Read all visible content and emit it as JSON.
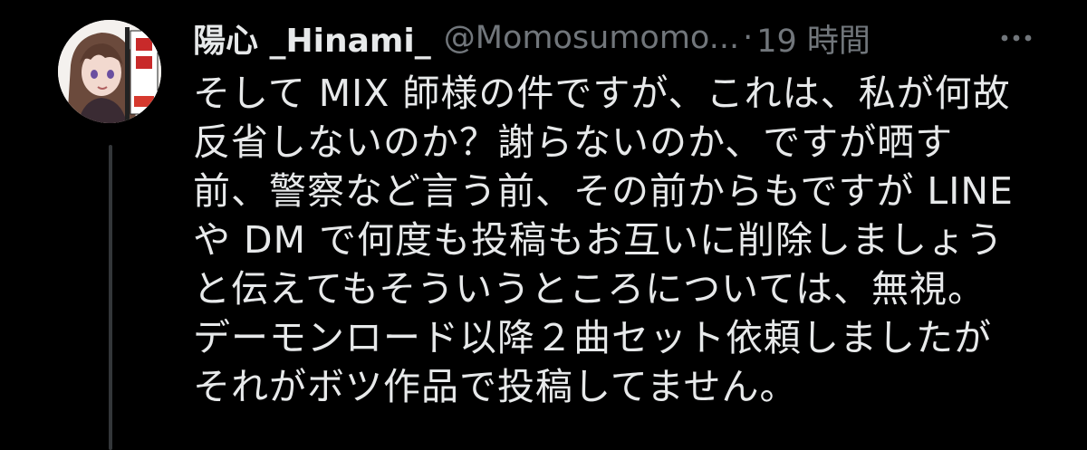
{
  "tweet": {
    "display_name": "陽心 _Hinami_",
    "handle": "@Momosumomo...",
    "separator": "·",
    "time": "19 時間",
    "more_icon": "more-horizontal-icon",
    "lines": [
      "そして MIX 師様の件ですが、これは、私が何故",
      "反省しないのか？謝らないのか、ですが晒す",
      "前、警察など言う前、その前からもですが LINE",
      "や DM で何度も投稿もお互いに削除しましょう",
      "と伝えてもそういうところについては、無視。",
      "デーモンロード以降２曲セット依頼しましたが",
      "それがボツ作品で投稿してません。"
    ]
  },
  "colors": {
    "background": "#000000",
    "primary_text": "#e7e9ea",
    "secondary_text": "#71767b",
    "thread_line": "#333639"
  }
}
